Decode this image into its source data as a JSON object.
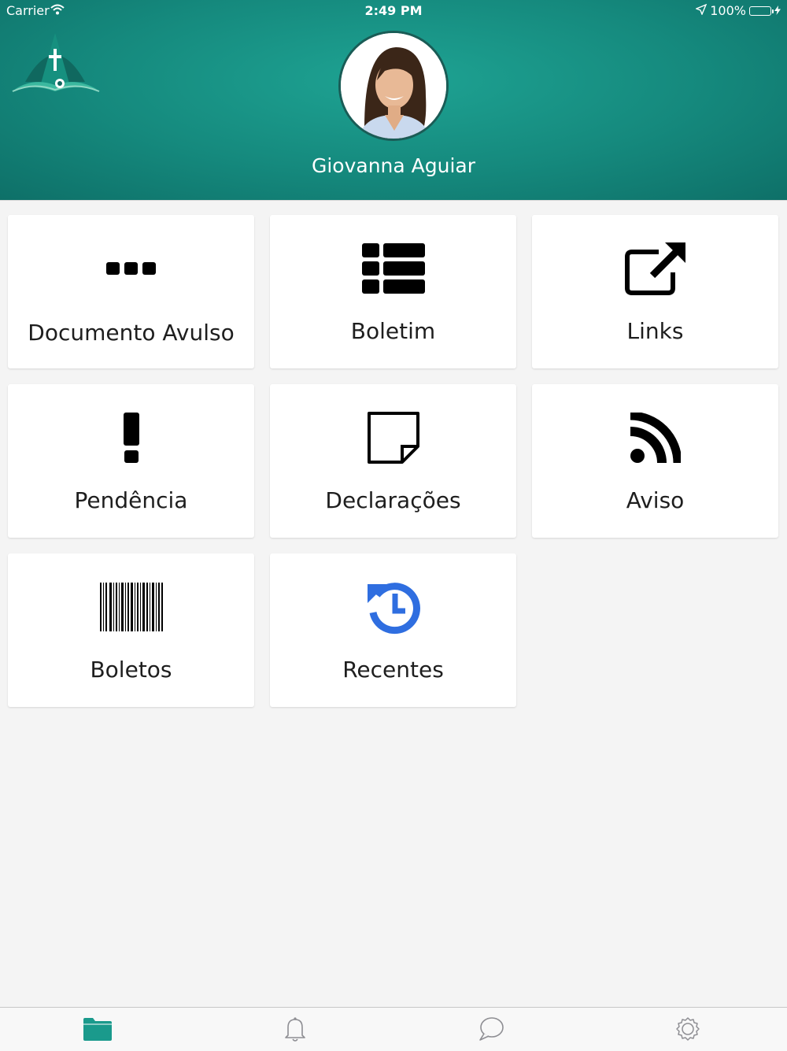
{
  "status_bar": {
    "carrier": "Carrier",
    "time": "2:49 PM",
    "battery": "100%"
  },
  "profile": {
    "name": "Giovanna Aguiar"
  },
  "tiles": [
    {
      "label": "Documento Avulso",
      "icon": "ellipsis-icon"
    },
    {
      "label": "Boletim",
      "icon": "list-icon"
    },
    {
      "label": "Links",
      "icon": "external-link-icon"
    },
    {
      "label": "Pendência",
      "icon": "exclamation-icon"
    },
    {
      "label": "Declarações",
      "icon": "sticky-note-icon"
    },
    {
      "label": "Aviso",
      "icon": "rss-icon"
    },
    {
      "label": "Boletos",
      "icon": "barcode-icon"
    },
    {
      "label": "Recentes",
      "icon": "history-icon"
    }
  ],
  "tabbar": {
    "items": [
      "folder-icon",
      "bell-icon",
      "chat-icon",
      "settings-icon"
    ],
    "active": "folder-icon"
  },
  "colors": {
    "header": "#15897d",
    "accent": "#1a9a8c",
    "recent_icon": "#2f6ee0"
  }
}
